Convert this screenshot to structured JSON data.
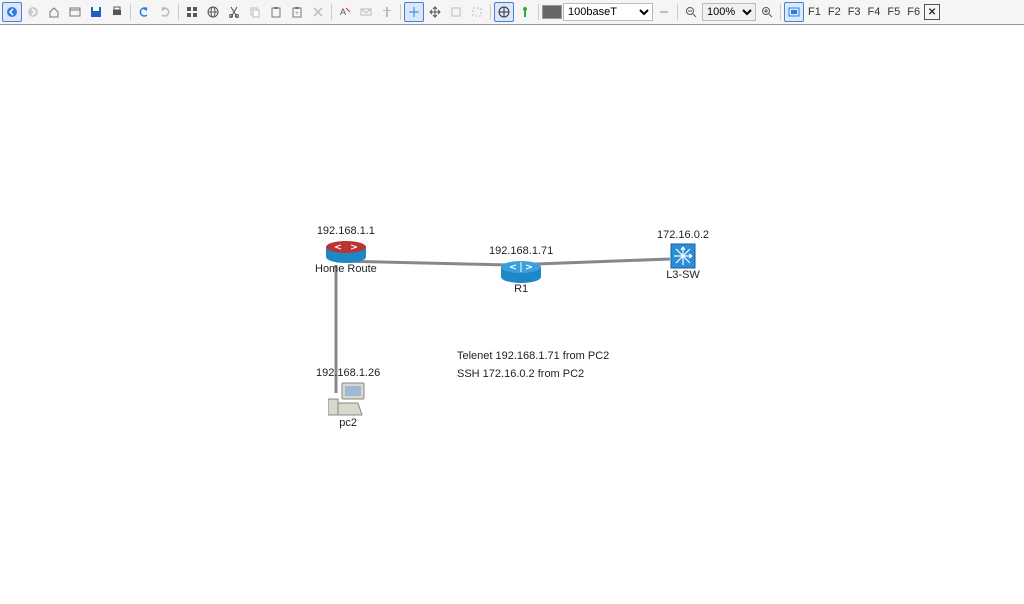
{
  "toolbar": {
    "link_select": "100baseT",
    "zoom": "100%",
    "fbuttons": [
      "F1",
      "F2",
      "F3",
      "F4",
      "F5",
      "F6"
    ]
  },
  "nodes": {
    "home_router": {
      "ip": "192.168.1.1",
      "label": "Home Route"
    },
    "r1": {
      "ip": "192.168.1.71",
      "label": "R1"
    },
    "l3sw": {
      "ip": "172.16.0.2",
      "label": "L3-SW"
    },
    "pc2": {
      "ip": "192.168.1.26",
      "label": "pc2"
    }
  },
  "notes": {
    "line1": "Telenet 192.168.1.71 from PC2",
    "line2": "SSH 172.16.0.2 from PC2"
  }
}
